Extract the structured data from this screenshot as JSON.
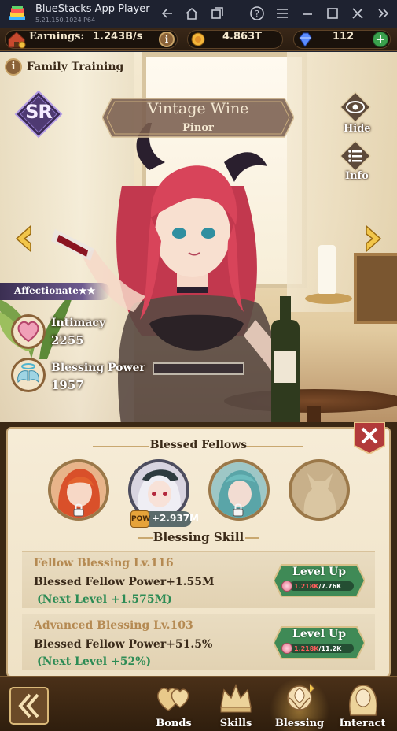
{
  "window": {
    "app_title": "BlueStacks App Player",
    "version": "5.21.150.1024  P64"
  },
  "resources": {
    "earnings_label": "Earnings:",
    "earnings_value": "1.243B/s",
    "gold_value": "4.863T",
    "gems_value": "112"
  },
  "header": {
    "family_training_label": "Family Training",
    "rarity": "SR",
    "character_name": "Vintage Wine",
    "character_subtitle": "Pinor",
    "hide_label": "Hide",
    "info_label": "Info",
    "affection_label": "Affectionate★★"
  },
  "stats": {
    "intimacy_label": "Intimacy",
    "intimacy_value": "2255",
    "blessing_power_label": "Blessing Power",
    "blessing_power_value": "1957"
  },
  "panel": {
    "blessed_fellows_title": "Blessed Fellows",
    "pow_badge_icon": "POW",
    "pow_badge_value": "+2.937M",
    "blessing_skill_title": "Blessing Skill",
    "skills": [
      {
        "name": "Fellow Blessing  Lv.116",
        "effect": "Blessed Fellow Power+1.55M",
        "next": "(Next Level +1.575M)",
        "button_label": "Level Up",
        "cost_have": "1.218K",
        "cost_need": "/7.76K"
      },
      {
        "name": "Advanced Blessing  Lv.103",
        "effect": "Blessed Fellow Power+51.5%",
        "next": "(Next Level +52%)",
        "button_label": "Level Up",
        "cost_have": "1.218K",
        "cost_need": "/11.2K"
      }
    ]
  },
  "nav": {
    "items": [
      {
        "label": "Bonds",
        "icon": "hearts-icon"
      },
      {
        "label": "Skills",
        "icon": "crown-icon"
      },
      {
        "label": "Blessing",
        "icon": "rose-icon"
      },
      {
        "label": "Interact",
        "icon": "portrait-icon"
      }
    ]
  },
  "colors": {
    "accent_gold": "#c9a468",
    "button_green": "#3f8a56",
    "close_red": "#b23a3a",
    "next_level_green": "#2d8c55"
  }
}
